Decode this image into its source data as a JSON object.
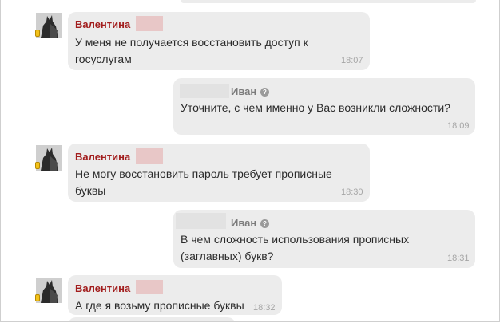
{
  "chat": {
    "messages": [
      {
        "sender": "Валентина",
        "text_line1": "У меня не получается восстановить доступ к",
        "text_line2": "госуслугам",
        "time": "18:07"
      },
      {
        "sender": "Иван",
        "help_icon": "?",
        "text_line1": "Уточните, с чем именно у Вас возникли сложности?",
        "time": "18:09"
      },
      {
        "sender": "Валентина",
        "text_line1": "Не могу восстановить пароль требует прописные",
        "text_line2": "буквы",
        "time": "18:30"
      },
      {
        "sender": "Иван",
        "help_icon": "?",
        "text_line1": "В чем сложность использования прописных",
        "text_line2": "(заглавных) букв?",
        "time": "18:31"
      },
      {
        "sender": "Валентина",
        "text_line1": "А где я возьму прописные буквы",
        "time": "18:32"
      }
    ]
  },
  "icons": {
    "avatar": "avatar-image",
    "status": "mobile-status-icon",
    "help": "question-circle-icon"
  },
  "colors": {
    "bubble": "#ececec",
    "user_name": "#a21d1d",
    "agent_name": "#7b7b7b",
    "text": "#2b2b2b",
    "time": "#a5a5a5",
    "status": "#f3c21a"
  }
}
